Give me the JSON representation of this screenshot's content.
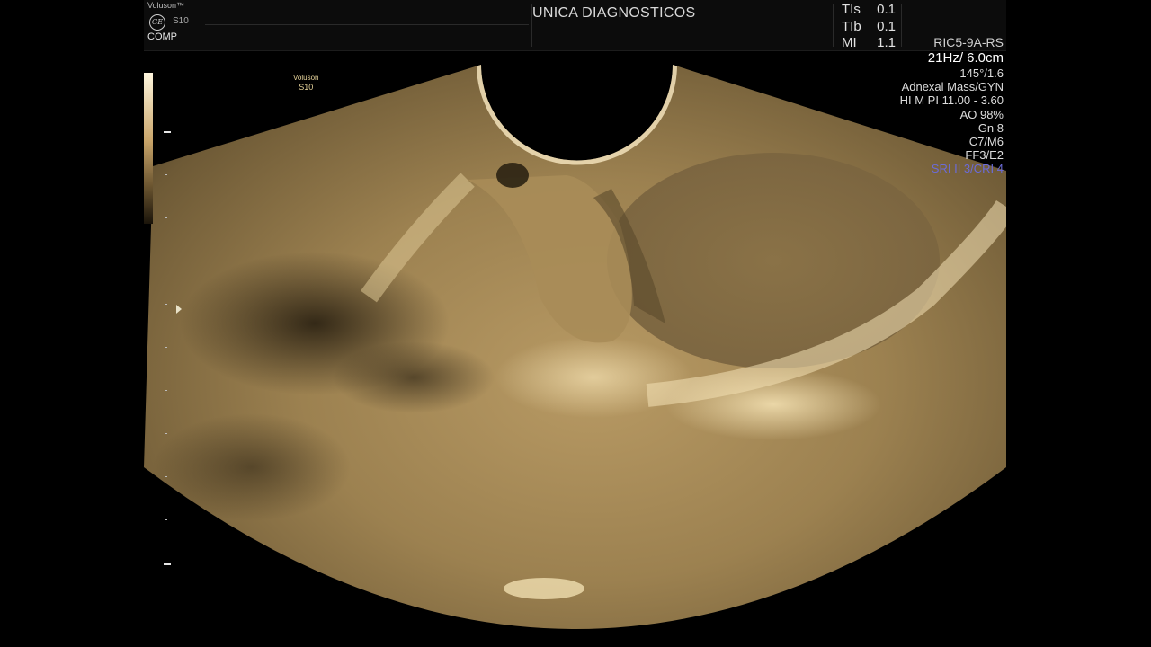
{
  "header": {
    "brand": "Voluson™",
    "logo": "GE",
    "model": "S10",
    "mode": "COMP",
    "institution": "UNICA DIAGNOSTICOS",
    "indices": [
      {
        "label": "TIs",
        "value": "0.1"
      },
      {
        "label": "TIb",
        "value": "0.1"
      },
      {
        "label": "MI",
        "value": "1.1"
      }
    ]
  },
  "params": {
    "probe": "RIC5-9A-RS",
    "frequency_depth": "21Hz/ 6.0cm",
    "angle": "145°/1.6",
    "preset": "Adnexal Mass/GYN",
    "hi_mode": "HI M PI 11.00 - 3.60",
    "ao": "AO 98%",
    "gain": "Gn   8",
    "maps": "C7/M6",
    "filters": "FF3/E2",
    "sri": "SRI II 3/CRI 4"
  },
  "watermark": {
    "line1": "Voluson",
    "line2": "S10"
  },
  "colors": {
    "tint": "#c9a56a",
    "sri": "#6b6bd8",
    "background": "#000000"
  }
}
